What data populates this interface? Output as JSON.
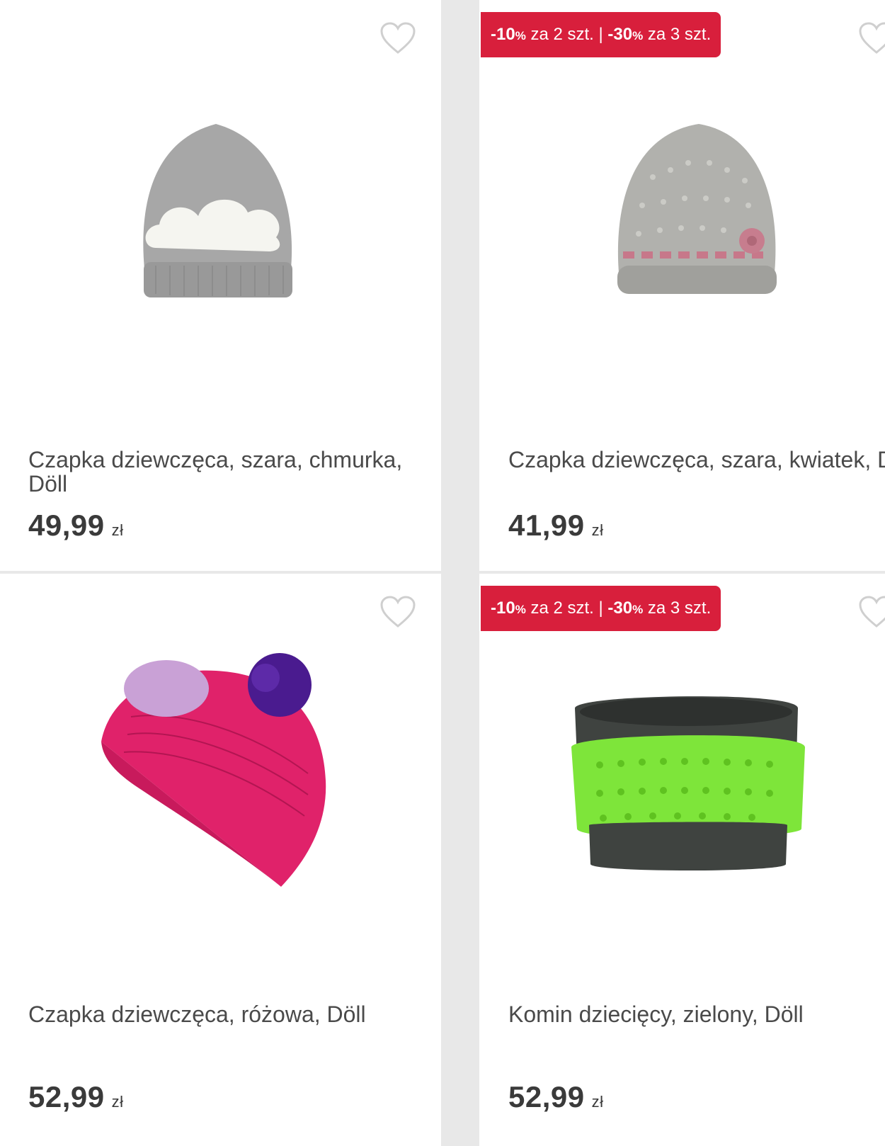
{
  "products": [
    {
      "title": "Czapka dziewczęca, szara, chmurka, Döll",
      "price": "49,99",
      "currency": "zł",
      "image": "gray-knit-hat-with-cloud"
    },
    {
      "promo": {
        "part1": "-10",
        "pct1": "%",
        "text1": " za 2 szt. | ",
        "part2": "-30",
        "pct2": "%",
        "text2": " za 3 szt."
      },
      "title": "Czapka dziewczęca, szara, kwiatek, Döll",
      "price": "41,99",
      "currency": "zł",
      "image": "gray-knit-hat-with-pink-flower"
    },
    {
      "title": "Czapka dziewczęca, różowa, Döll",
      "price": "52,99",
      "currency": "zł",
      "image": "pink-knit-hat-with-purple-pompom"
    },
    {
      "promo": {
        "part1": "-10",
        "pct1": "%",
        "text1": " za 2 szt. | ",
        "part2": "-30",
        "pct2": "%",
        "text2": " za 3 szt."
      },
      "title": "Komin dziecięcy, zielony, Döll",
      "price": "52,99",
      "currency": "zł",
      "image": "green-gray-knit-neck-warmer"
    }
  ],
  "colors": {
    "promo_badge": "#d81f3c",
    "heart_outline": "#cfcfcf",
    "divider": "#e8e8e8"
  }
}
